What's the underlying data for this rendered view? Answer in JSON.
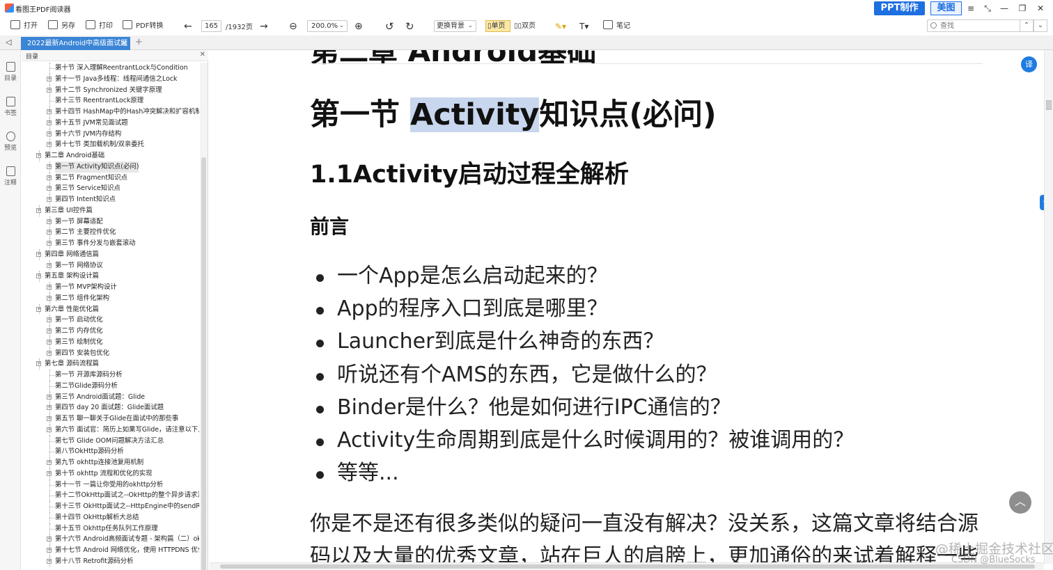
{
  "app": {
    "title": "看图王PDF阅读器",
    "ppt_button": "PPT制作",
    "meitu_button": "美图"
  },
  "toolbar": {
    "open": "打开",
    "save_as": "另存",
    "print": "打印",
    "pdf_convert": "PDF转换",
    "current_page": "165",
    "total_pages": "/1932页",
    "zoom": "200.0%",
    "background": "更换背景",
    "single_page": "单页",
    "double_page": "双页",
    "notes": "笔记",
    "search_placeholder": "查找"
  },
  "tab": {
    "label": "2022最新Android中高级面试题"
  },
  "left_strip": {
    "outline": "目录",
    "bookmark": "书签",
    "preview": "预览",
    "annotation": "注释"
  },
  "outline": {
    "title": "目录",
    "items": [
      {
        "label": "第十节 深入理解ReentrantLock与Condition",
        "level": 2,
        "toggle": false
      },
      {
        "label": "第十一节 Java多线程：线程间通信之Lock",
        "level": 2,
        "toggle": true
      },
      {
        "label": "第十二节 Synchronized 关键字原理",
        "level": 2,
        "toggle": true
      },
      {
        "label": "第十三节 ReentrantLock原理",
        "level": 2,
        "toggle": false
      },
      {
        "label": "第十四节 HashMap中的Hash冲突解决和扩容机制",
        "level": 2,
        "toggle": true
      },
      {
        "label": "第十五节 JVM常见面试题",
        "level": 2,
        "toggle": true
      },
      {
        "label": "第十六节 JVM内存结构",
        "level": 2,
        "toggle": true
      },
      {
        "label": "第十七节 类加载机制/双亲委托",
        "level": 2,
        "toggle": true
      },
      {
        "label": "第二章 Android基础",
        "level": 1,
        "toggle": true
      },
      {
        "label": "第一节 Activity知识点(必问)",
        "level": 2,
        "toggle": true,
        "selected": true
      },
      {
        "label": "第二节 Fragment知识点",
        "level": 2,
        "toggle": true
      },
      {
        "label": "第三节 Service知识点",
        "level": 2,
        "toggle": true
      },
      {
        "label": "第四节 Intent知识点",
        "level": 2,
        "toggle": true
      },
      {
        "label": "第三章 UI控件篇",
        "level": 1,
        "toggle": true
      },
      {
        "label": "第一节 屏幕适配",
        "level": 2,
        "toggle": true
      },
      {
        "label": "第二节 主要控件优化",
        "level": 2,
        "toggle": true
      },
      {
        "label": "第三节 事件分发与嵌套滚动",
        "level": 2,
        "toggle": true
      },
      {
        "label": "第四章 网络通信篇",
        "level": 1,
        "toggle": true
      },
      {
        "label": "第一节 网络协议",
        "level": 2,
        "toggle": true
      },
      {
        "label": "第五章 架构设计篇",
        "level": 1,
        "toggle": true
      },
      {
        "label": "第一节 MVP架构设计",
        "level": 2,
        "toggle": true
      },
      {
        "label": "第二节 组件化架构",
        "level": 2,
        "toggle": true
      },
      {
        "label": "第六章 性能优化篇",
        "level": 1,
        "toggle": true
      },
      {
        "label": "第一节 启动优化",
        "level": 2,
        "toggle": true
      },
      {
        "label": "第二节 内存优化",
        "level": 2,
        "toggle": true
      },
      {
        "label": "第三节 绘制优化",
        "level": 2,
        "toggle": true
      },
      {
        "label": "第四节 安装包优化",
        "level": 2,
        "toggle": true
      },
      {
        "label": "第七章 源码流程篇",
        "level": 1,
        "toggle": true
      },
      {
        "label": "第一节 开源库源码分析",
        "level": 2,
        "toggle": false
      },
      {
        "label": "第二节Glide源码分析",
        "level": 2,
        "toggle": false
      },
      {
        "label": "第三节 Android面试题：Glide",
        "level": 2,
        "toggle": true
      },
      {
        "label": "第四节 day 20 面试题：Glide面试题",
        "level": 2,
        "toggle": true
      },
      {
        "label": "第五节 聊一聊关于Glide在面试中的那些事",
        "level": 2,
        "toggle": true
      },
      {
        "label": "第六节 面试官：简历上如果写Glide，请注意以下几点",
        "level": 2,
        "toggle": true
      },
      {
        "label": "第七节 Glide OOM问题解决方法汇总",
        "level": 2,
        "toggle": false
      },
      {
        "label": "第八节OkHttp源码分析",
        "level": 2,
        "toggle": false
      },
      {
        "label": "第九节 okhttp连接池复用机制",
        "level": 2,
        "toggle": true
      },
      {
        "label": "第十节 okhttp 流程和优化的实现",
        "level": 2,
        "toggle": true
      },
      {
        "label": "第十一节 一篇让你受用的okhttp分析",
        "level": 2,
        "toggle": false
      },
      {
        "label": "第十二节OkHttp面试之--OkHttp的整个异步请求流程",
        "level": 2,
        "toggle": false
      },
      {
        "label": "第十三节 OkHttp面试之--HttpEngine中的sendRequest方法",
        "level": 2,
        "toggle": false
      },
      {
        "label": "第十四节 OkHttp解析大总结",
        "level": 2,
        "toggle": false
      },
      {
        "label": "第十五节 Okhttp任务队列工作原理",
        "level": 2,
        "toggle": false
      },
      {
        "label": "第十六节 Android高频面试专题 - 架构篇（二）okhttp面试必知必会",
        "level": 2,
        "toggle": true
      },
      {
        "label": "第十七节 Android 网络优化，使用 HTTPDNS 优化 DNS",
        "level": 2,
        "toggle": true
      },
      {
        "label": "第十八节 Retrofit源码分析",
        "level": 2,
        "toggle": true
      }
    ]
  },
  "document": {
    "chapter_heading": "第二章 Android基础",
    "section_prefix": "第一节 ",
    "section_highlight": "Activity",
    "section_suffix": "知识点(必问)",
    "subsection_heading": "1.1Activity启动过程全解析",
    "preface_heading": "前言",
    "bullets": [
      "一个App是怎么启动起来的？",
      "App的程序入口到底是哪里？",
      "Launcher到底是什么神奇的东西？",
      "听说还有个AMS的东西，它是做什么的？",
      "Binder是什么？他是如何进行IPC通信的？",
      "Activity生命周期到底是什么时候调用的？被谁调用的？",
      "等等..."
    ],
    "paragraph_lines": [
      "你是不是还有很多类似的疑问一直没有解决？没关系，这篇文章将结合源",
      "码以及大量的优秀文章，站在巨人的肩膀上，更加通俗的来试着解释一些"
    ]
  },
  "watermark": {
    "line1": "@稀土掘金技术社区",
    "line2": "CSDN @BlueSocks"
  },
  "colors": {
    "accent": "#1e6fe0",
    "tab_active": "#3b85d6",
    "selection": "#c8d6ee",
    "single_page_active": "#fbe8a6"
  }
}
